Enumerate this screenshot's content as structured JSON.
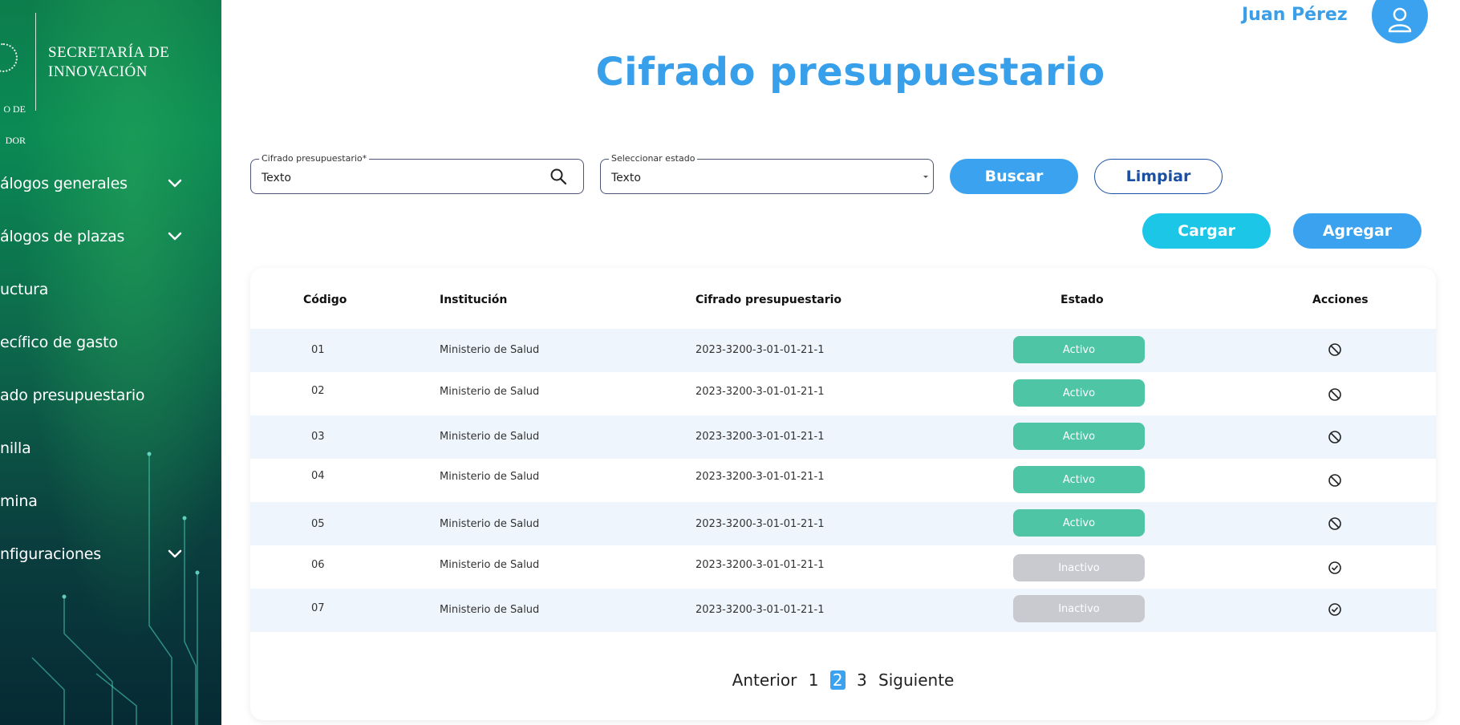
{
  "brand": {
    "name_line1": "SECRETARÍA DE",
    "name_line2": "INNOVACIÓN",
    "sub_line1": "O DE",
    "sub_line2": "DOR"
  },
  "sidebar": {
    "items": [
      {
        "label": "álogos generales",
        "chevron": true
      },
      {
        "label": "álogos de plazas",
        "chevron": true
      },
      {
        "label": "uctura",
        "chevron": false
      },
      {
        "label": "ecífico de gasto",
        "chevron": false
      },
      {
        "label": "ado presupuestario",
        "chevron": false
      },
      {
        "label": "nilla",
        "chevron": false
      },
      {
        "label": "mina",
        "chevron": false
      },
      {
        "label": "nfiguraciones",
        "chevron": true
      }
    ]
  },
  "header": {
    "user_name": "Juan Pérez",
    "title": "Cifrado presupuestario"
  },
  "filters": {
    "cifrado_legend": "Cifrado presupuestario*",
    "cifrado_value": "Texto",
    "estado_legend": "Seleccionar estado",
    "estado_value": "Texto",
    "buscar": "Buscar",
    "limpiar": "Limpiar",
    "cargar": "Cargar",
    "agregar": "Agregar"
  },
  "table": {
    "headers": [
      "Código",
      "Institución",
      "Cifrado presupuestario",
      "Estado",
      "Acciones"
    ],
    "rows": [
      {
        "codigo": "01",
        "institucion": "Ministerio de Salud",
        "cifrado": "2023-3200-3-01-01-21-1",
        "estado": "Activo",
        "action_icon": "ban-icon"
      },
      {
        "codigo": "02",
        "institucion": "Ministerio de Salud",
        "cifrado": "2023-3200-3-01-01-21-1",
        "estado": "Activo",
        "action_icon": "ban-icon"
      },
      {
        "codigo": "03",
        "institucion": "Ministerio de Salud",
        "cifrado": "2023-3200-3-01-01-21-1",
        "estado": "Activo",
        "action_icon": "ban-icon"
      },
      {
        "codigo": "04",
        "institucion": "Ministerio de Salud",
        "cifrado": "2023-3200-3-01-01-21-1",
        "estado": "Activo",
        "action_icon": "ban-icon"
      },
      {
        "codigo": "05",
        "institucion": "Ministerio de Salud",
        "cifrado": "2023-3200-3-01-01-21-1",
        "estado": "Activo",
        "action_icon": "ban-icon"
      },
      {
        "codigo": "06",
        "institucion": "Ministerio de Salud",
        "cifrado": "2023-3200-3-01-01-21-1",
        "estado": "Inactivo",
        "action_icon": "check-circle-icon"
      },
      {
        "codigo": "07",
        "institucion": "Ministerio de Salud",
        "cifrado": "2023-3200-3-01-01-21-1",
        "estado": "Inactivo",
        "action_icon": "check-circle-icon"
      }
    ]
  },
  "pagination": {
    "prev": "Anterior",
    "pages": [
      "1",
      "2",
      "3"
    ],
    "current": "2",
    "next": "Siguiente"
  },
  "colors": {
    "accent": "#3aa2ee",
    "active": "#4ec5a5",
    "inactive": "#c8cad0",
    "outline": "#1b4fa3",
    "cyan": "#1cc6e6"
  }
}
